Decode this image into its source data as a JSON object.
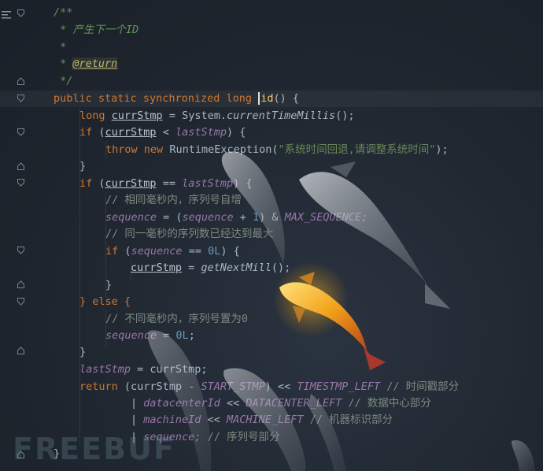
{
  "editor": {
    "lines": [
      {
        "id": "l1",
        "text": "/**"
      },
      {
        "id": "l2",
        "text": " * 产生下一个ID"
      },
      {
        "id": "l3",
        "text": " *"
      },
      {
        "id": "l4a",
        "text": " * "
      },
      {
        "id": "l4b",
        "text": "@return"
      },
      {
        "id": "l5",
        "text": " */"
      }
    ],
    "tokens": {
      "public": "public",
      "static": "static",
      "synchronized": "synchronized",
      "long": "long",
      "id_method": "id",
      "paren_open": "() {",
      "currStmp": "currStmp",
      "eq": " = System.",
      "currentTimeMillis": "currentTimeMillis",
      "call_end": "();",
      "if": "if",
      "lt": " < ",
      "lastStmp": "lastStmp",
      "close_paren_brace": ") {",
      "throw": "throw",
      "new": "new",
      "RuntimeException": "RuntimeException(",
      "exception_msg": "\"系统时间回退,请调整系统时间\"",
      "exception_end": ");",
      "brace_close": "}",
      "eqeq": " == ",
      "comment_same_ms": "// 相同毫秒内，序列号自增",
      "sequence": "sequence",
      "assign": " = (",
      "plus": " + ",
      "one": "1",
      "amp": ") & ",
      "MAX_SEQUENCE": "MAX_SEQUENCE;",
      "comment_full": "// 同一毫秒的序列数已经达到最大",
      "zeroL": "0L",
      "getNextMill": "getNextMill",
      "else": "} else {",
      "comment_diff_ms": "// 不同毫秒内，序列号置为0",
      "seq_zero": " = ",
      "semicolon": ";",
      "lastStmp_assign": " = currStmp;",
      "return": "return",
      "minus": " - ",
      "START_STMP": "START_STMP",
      "shl": ") << ",
      "TIMESTMP_LEFT": "TIMESTMP_LEFT",
      "comment_ts": "// 时间戳部分",
      "pipe": "| ",
      "datacenterId": "datacenterId",
      "shl2": " << ",
      "DATACENTER_LEFT": "DATACENTER_LEFT",
      "comment_dc": "// 数据中心部分",
      "machineId": "machineId",
      "MACHINE_LEFT": "MACHINE_LEFT",
      "comment_machine": "// 机器标识部分",
      "seq_end": "sequence;",
      "comment_seq": "// 序列号部分",
      "final_brace": "}"
    }
  },
  "watermark": "FREEBUF",
  "colors": {
    "background": "#1f262f",
    "keyword": "#cc7832",
    "field": "#9876aa",
    "string": "#6a8759",
    "number": "#6897bb",
    "function": "#ffc66d"
  }
}
